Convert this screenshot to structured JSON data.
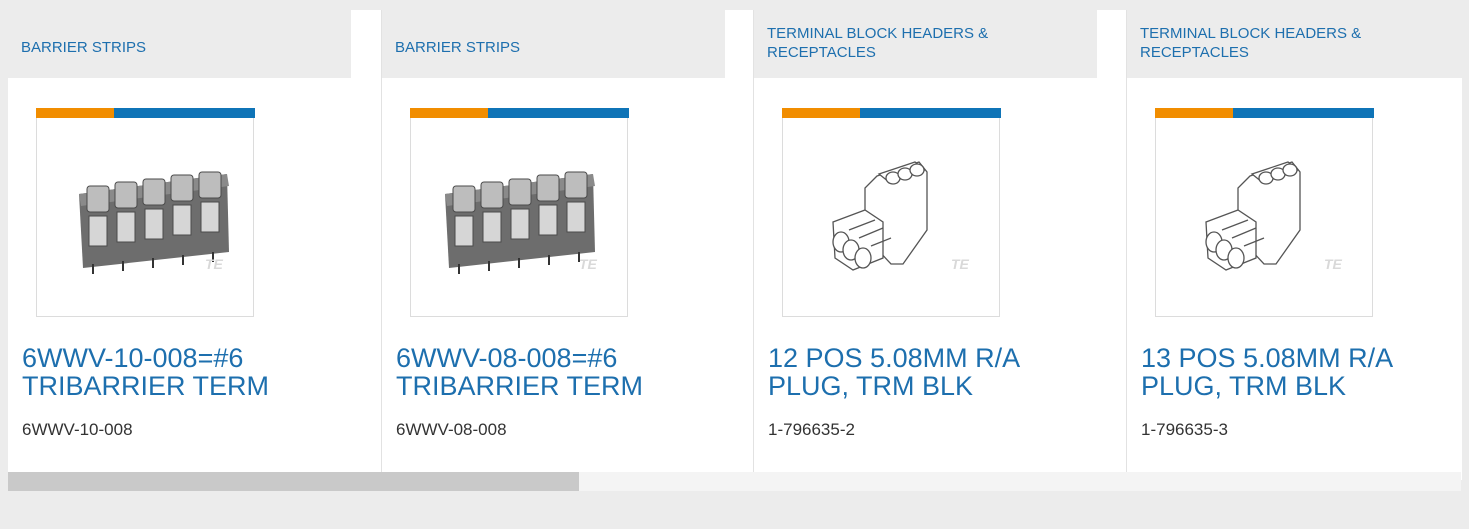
{
  "products": [
    {
      "category": "BARRIER STRIPS",
      "title": "6WWV-10-008=#6 TRIBARRIER TERM",
      "part_number": "6WWV-10-008",
      "image_icon": "barrier-strip-image"
    },
    {
      "category": "BARRIER STRIPS",
      "title": "6WWV-08-008=#6 TRIBARRIER TERM",
      "part_number": "6WWV-08-008",
      "image_icon": "barrier-strip-image"
    },
    {
      "category": "TERMINAL BLOCK HEADERS & RECEPTACLES",
      "title": "12 POS 5.08MM R/A PLUG, TRM BLK",
      "part_number": "1-796635-2",
      "image_icon": "terminal-plug-image"
    },
    {
      "category": "TERMINAL BLOCK HEADERS & RECEPTACLES",
      "title": "13 POS 5.08MM R/A PLUG, TRM BLK",
      "part_number": "1-796635-3",
      "image_icon": "terminal-plug-image"
    }
  ],
  "watermark": "TE",
  "scrollbar": {
    "position_fraction": 0.39
  },
  "colors": {
    "link": "#1d6fae",
    "accent_orange": "#f18d00",
    "accent_blue": "#0f74b7"
  }
}
